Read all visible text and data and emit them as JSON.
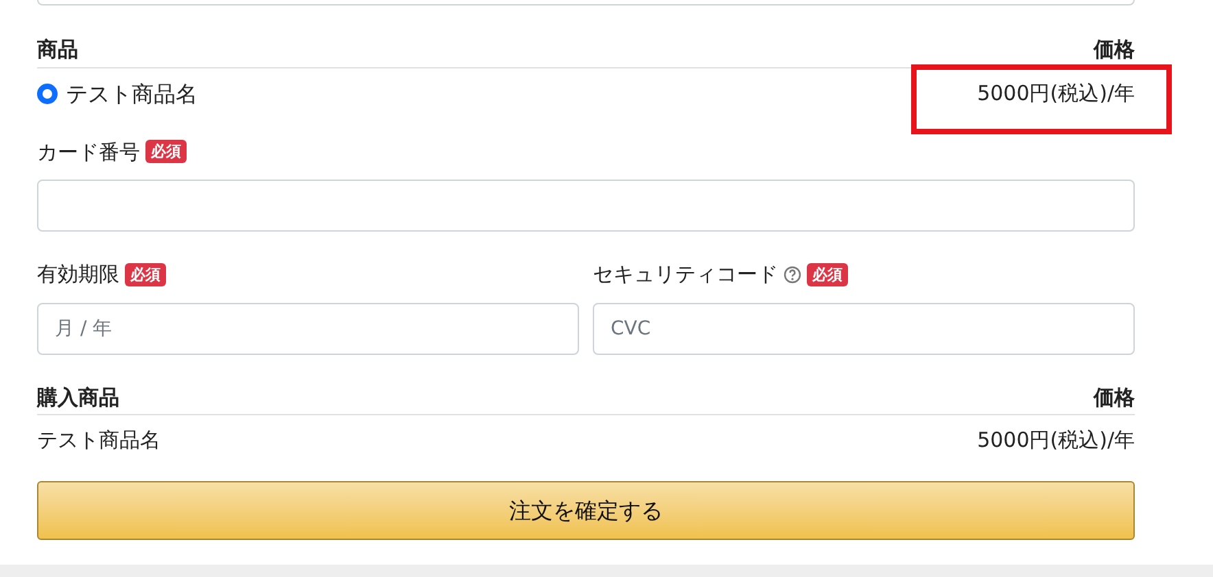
{
  "products": {
    "header_name": "商品",
    "header_price": "価格",
    "items": [
      {
        "name": "テスト商品名",
        "price": "5000円(税込)/年",
        "selected": true,
        "highlighted": true
      }
    ]
  },
  "card_number": {
    "label": "カード番号",
    "required": "必須"
  },
  "expiry": {
    "label": "有効期限",
    "required": "必須",
    "placeholder": "月 / 年"
  },
  "security_code": {
    "label": "セキュリティコード",
    "required": "必須",
    "placeholder": "CVC"
  },
  "summary": {
    "header_name": "購入商品",
    "header_price": "価格",
    "rows": [
      {
        "name": "テスト商品名",
        "price": "5000円(税込)/年"
      }
    ]
  },
  "submit_button": "注文を確定する"
}
